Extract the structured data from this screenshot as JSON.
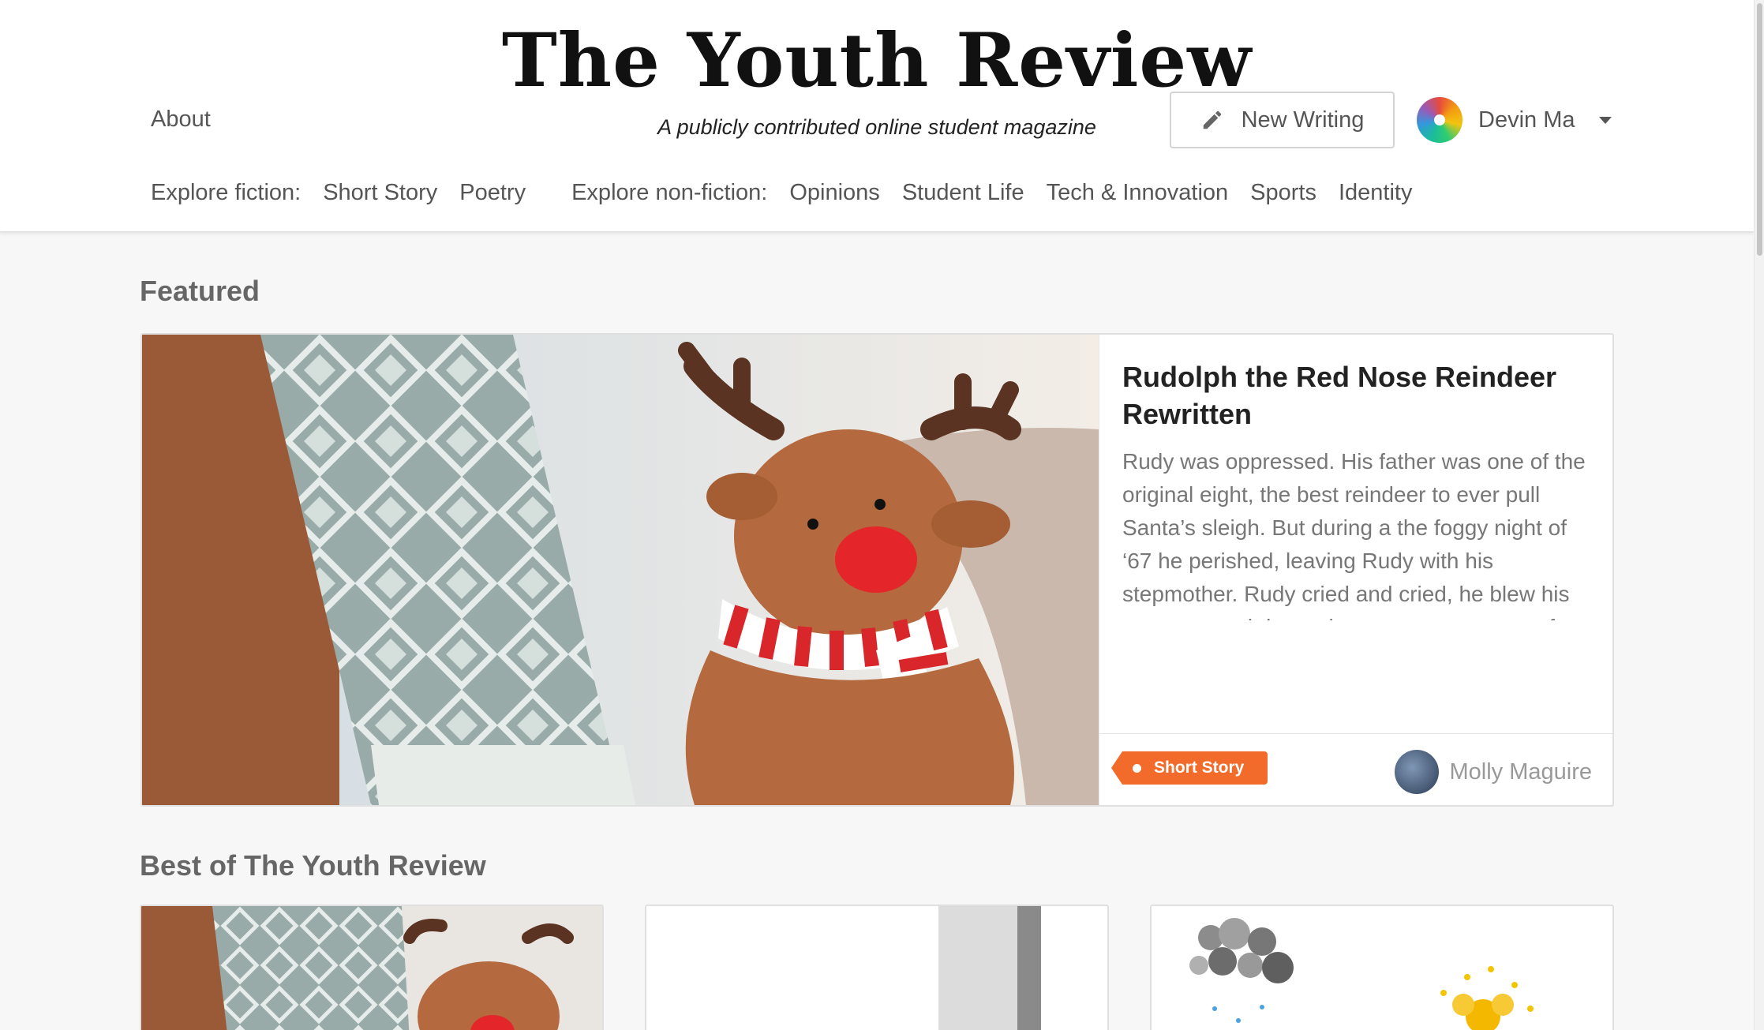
{
  "header": {
    "logo": "The Youth Review",
    "tagline": "A publicly contributed online student magazine",
    "about_label": "About",
    "new_writing_label": "New Writing",
    "user_name": "Devin Ma"
  },
  "nav": {
    "fiction_label": "Explore fiction:",
    "fiction_links": [
      "Short Story",
      "Poetry"
    ],
    "nonfiction_label": "Explore non-fiction:",
    "nonfiction_links": [
      "Opinions",
      "Student Life",
      "Tech & Innovation",
      "Sports",
      "Identity"
    ]
  },
  "featured": {
    "section_title": "Featured",
    "title": "Rudolph the Red Nose Reindeer Rewritten",
    "excerpt": "Rudy was oppressed. His father was one of the original eight, the best reindeer to ever pull Santa’s sleigh. But during a the foggy night of ‘67 he perished, leaving Rudy with his stepmother. Rudy cried and cried, he blew his nose so much it was in a permanent state of redness, so red that sometimes it was said to glow. He never really got over his father’s death, the bright red of his nose was...",
    "tag": "Short Story",
    "author": "Molly Maguire"
  },
  "best": {
    "section_title": "Best of The Youth Review"
  },
  "colors": {
    "tag": "#f26b2a",
    "background": "#f7f7f7",
    "header": "#ffffff"
  }
}
